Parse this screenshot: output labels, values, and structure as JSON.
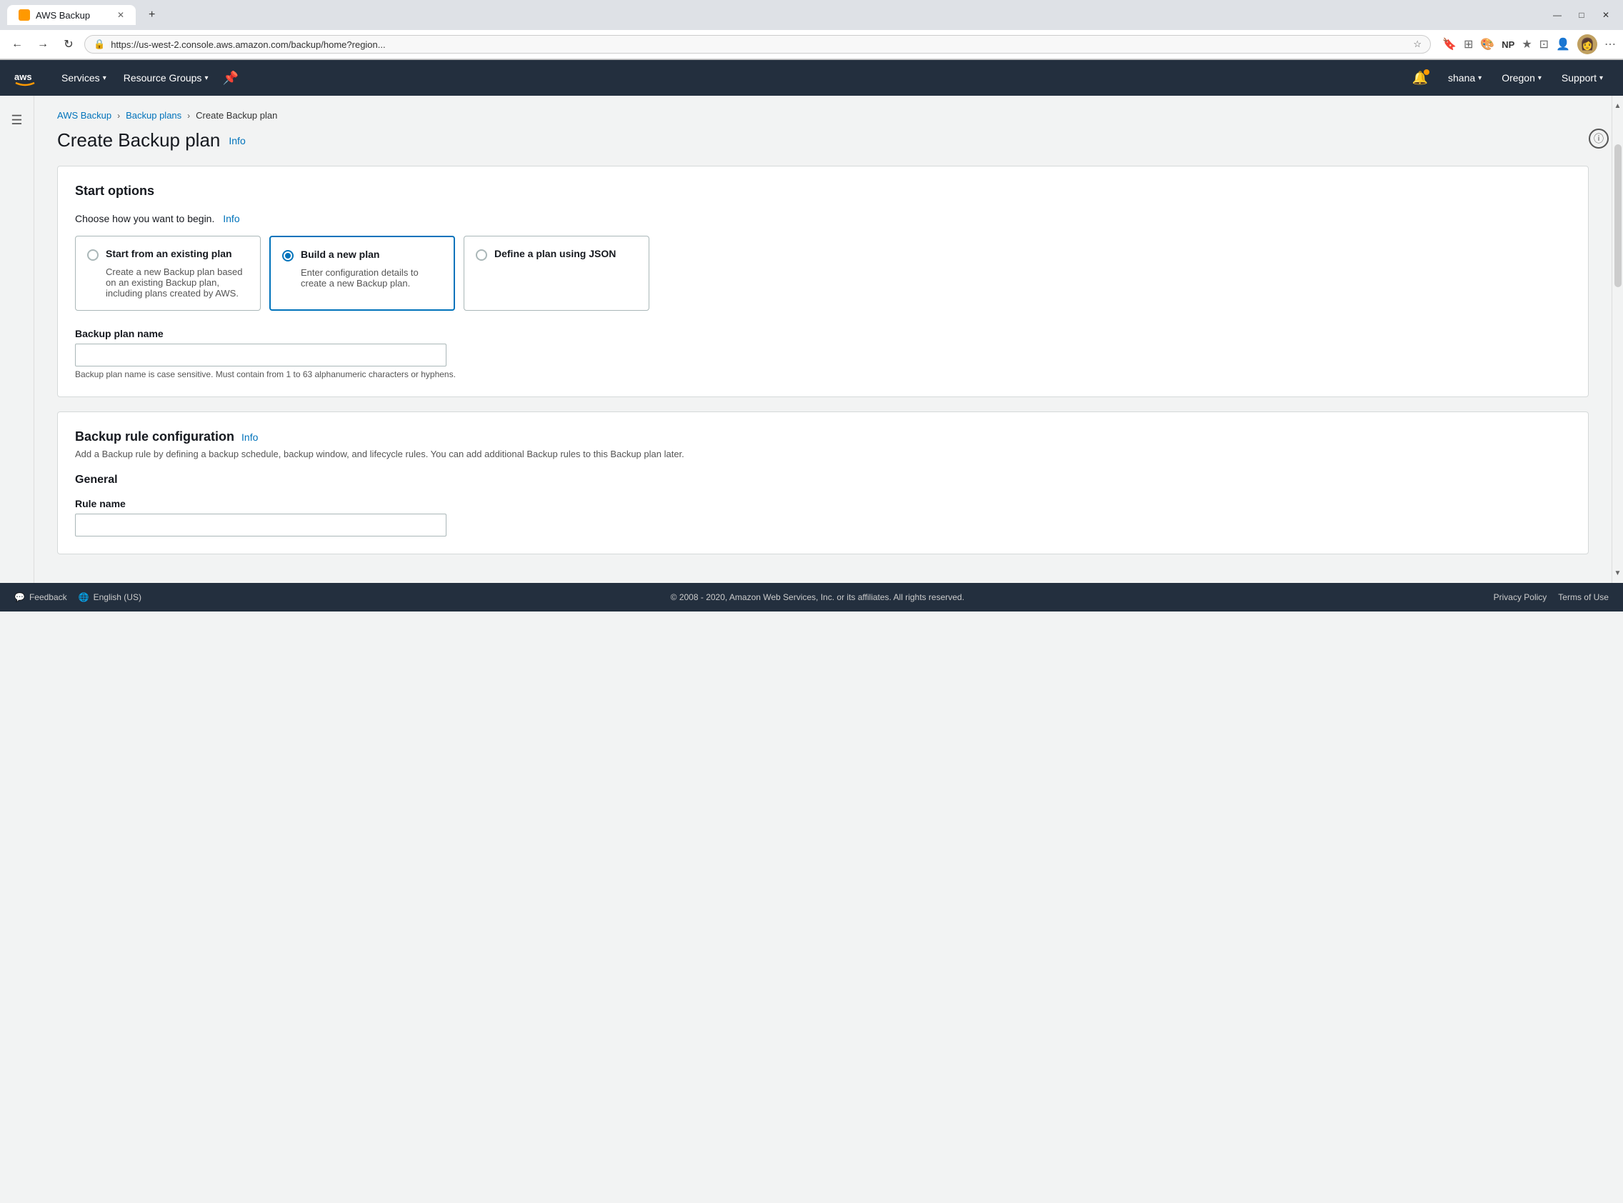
{
  "browser": {
    "tab_title": "AWS Backup",
    "url": "https://us-west-2.console.aws.amazon.com/backup/home?region...",
    "new_tab_icon": "+",
    "nav_back": "←",
    "nav_forward": "→",
    "nav_refresh": "↻"
  },
  "aws_nav": {
    "services_label": "Services",
    "resource_groups_label": "Resource Groups",
    "bell_label": "🔔",
    "user_label": "shana",
    "region_label": "Oregon",
    "support_label": "Support"
  },
  "breadcrumb": {
    "home": "AWS Backup",
    "plans": "Backup plans",
    "current": "Create Backup plan"
  },
  "page": {
    "title": "Create Backup plan",
    "info_label": "Info"
  },
  "start_options": {
    "card_title": "Start options",
    "choose_label": "Choose how you want to begin.",
    "choose_info": "Info",
    "options": [
      {
        "id": "existing",
        "title": "Start from an existing plan",
        "description": "Create a new Backup plan based on an existing Backup plan, including plans created by AWS.",
        "selected": false
      },
      {
        "id": "new",
        "title": "Build a new plan",
        "description": "Enter configuration details to create a new Backup plan.",
        "selected": true
      },
      {
        "id": "json",
        "title": "Define a plan using JSON",
        "description": "",
        "selected": false
      }
    ],
    "plan_name_label": "Backup plan name",
    "plan_name_placeholder": "",
    "plan_name_hint": "Backup plan name is case sensitive. Must contain from 1 to 63 alphanumeric characters or hyphens."
  },
  "backup_rule": {
    "card_title": "Backup rule configuration",
    "card_info": "Info",
    "card_subtitle": "Add a Backup rule by defining a backup schedule, backup window, and lifecycle rules. You can add additional Backup rules to this Backup plan later.",
    "general_heading": "General",
    "rule_name_label": "Rule name",
    "rule_name_placeholder": ""
  },
  "footer": {
    "feedback_label": "Feedback",
    "language_label": "English (US)",
    "copyright": "© 2008 - 2020, Amazon Web Services, Inc. or its affiliates. All rights reserved.",
    "privacy_label": "Privacy Policy",
    "terms_label": "Terms of Use"
  }
}
